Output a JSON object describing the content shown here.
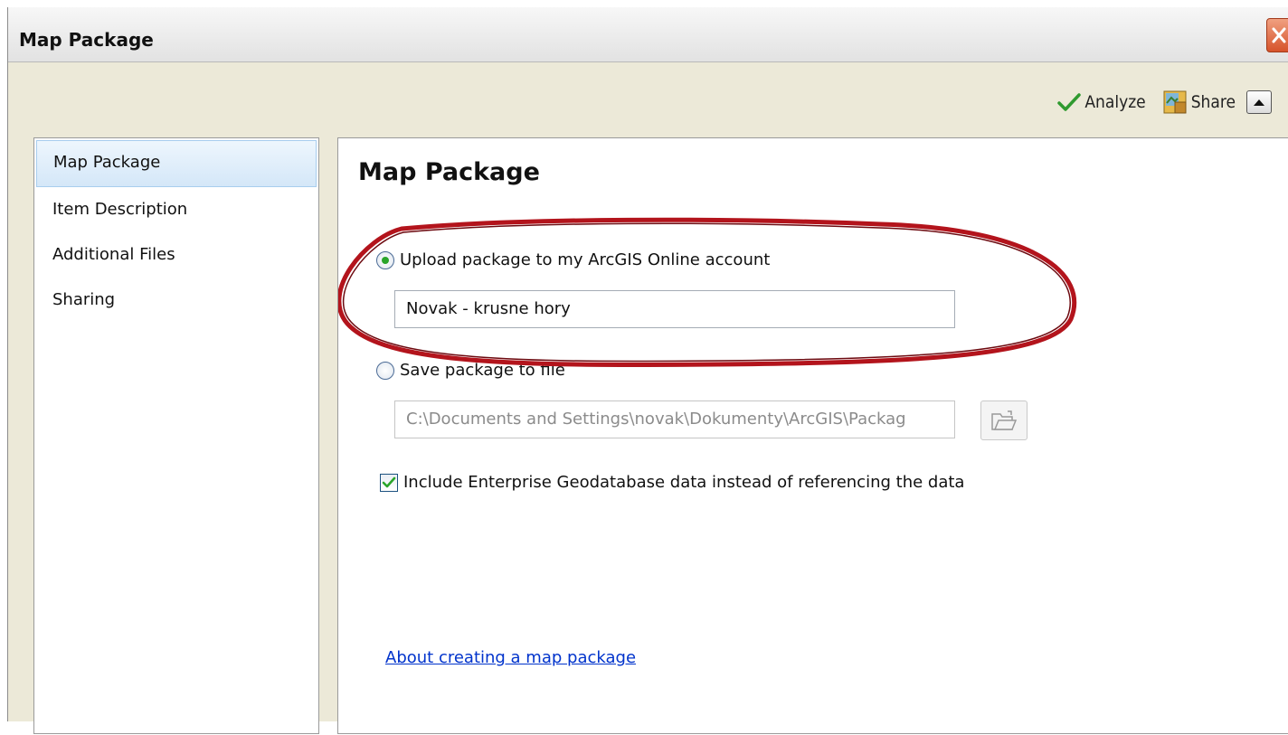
{
  "window": {
    "title": "Map Package"
  },
  "toolbar": {
    "analyze_label": "Analyze",
    "share_label": "Share"
  },
  "nav": {
    "items": [
      {
        "label": "Map Package",
        "active": true
      },
      {
        "label": "Item Description",
        "active": false
      },
      {
        "label": "Additional Files",
        "active": false
      },
      {
        "label": "Sharing",
        "active": false
      }
    ]
  },
  "content": {
    "title": "Map Package",
    "upload_option": {
      "label": "Upload package to my ArcGIS Online account",
      "selected": true,
      "value": "Novak - krusne hory"
    },
    "save_option": {
      "label": "Save package to file",
      "selected": false,
      "value": "C:\\Documents and Settings\\novak\\Dokumenty\\ArcGIS\\Packag"
    },
    "include_geodatabase": {
      "label": "Include Enterprise Geodatabase data instead of referencing the data",
      "checked": true
    },
    "help_link": "About creating a map package"
  },
  "colors": {
    "highlight_ring": "#b3141c",
    "link": "#0033cc",
    "check_green": "#2aa52a"
  }
}
